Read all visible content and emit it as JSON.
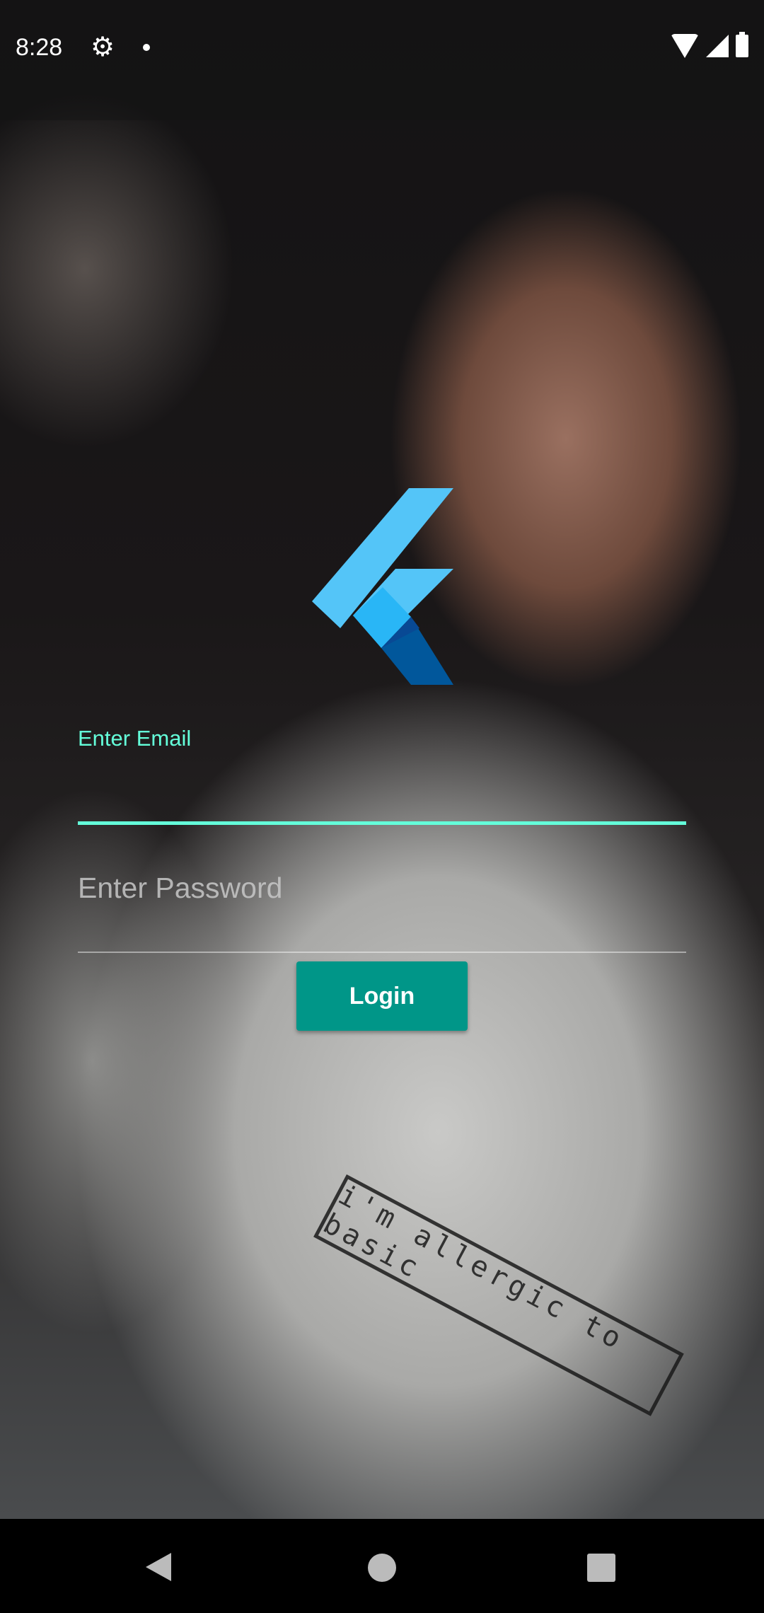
{
  "status_bar": {
    "time": "8:28",
    "icons": [
      "settings-icon",
      "notification-dot-icon",
      "wifi-icon",
      "signal-icon",
      "battery-icon"
    ]
  },
  "background": {
    "shirt_text": "i'm allergic to basic"
  },
  "form": {
    "email_label": "Enter Email",
    "email_value": "",
    "password_placeholder": "Enter Password",
    "login_label": "Login"
  },
  "colors": {
    "accent": "#64ffda",
    "button": "#009688"
  },
  "nav_bar": {
    "icons": [
      "back-icon",
      "home-icon",
      "recents-icon"
    ]
  }
}
